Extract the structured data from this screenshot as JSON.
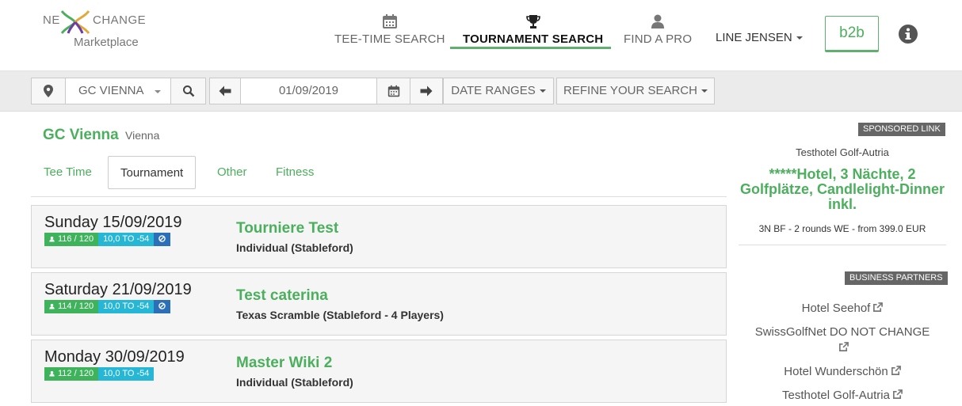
{
  "brand": {
    "logo_left": "NE",
    "logo_right": "CHANGE",
    "logo_sub": "Marketplace",
    "accent_color": "#4caf5d"
  },
  "nav": {
    "items": [
      {
        "label": "TEE-TIME SEARCH",
        "icon": "calendar-icon",
        "active": false
      },
      {
        "label": "TOURNAMENT SEARCH",
        "icon": "trophy-icon",
        "active": true
      },
      {
        "label": "FIND A PRO",
        "icon": "user-icon",
        "active": false
      }
    ],
    "user_name": "LINE JENSEN",
    "b2b_label": "b2b",
    "info_icon": "info-circle-icon"
  },
  "search": {
    "location_icon": "map-marker-icon",
    "club": "GC VIENNA",
    "search_icon": "search-icon",
    "prev_icon": "arrow-left-icon",
    "date": "01/09/2019",
    "calendar_icon": "calendar-icon",
    "next_icon": "arrow-right-icon",
    "date_ranges": "DATE RANGES",
    "refine": "REFINE YOUR SEARCH"
  },
  "club": {
    "name": "GC Vienna",
    "city": "Vienna"
  },
  "tabs": [
    {
      "label": "Tee Time",
      "active": false
    },
    {
      "label": "Tournament",
      "active": true
    },
    {
      "label": "Other",
      "active": false
    },
    {
      "label": "Fitness",
      "active": false
    }
  ],
  "events": [
    {
      "date": "Sunday 15/09/2019",
      "spots": "116 / 120",
      "handicap": "10,0 TO -54",
      "has_ban": true,
      "name": "Tourniere Test",
      "format": "Individual (Stableford)"
    },
    {
      "date": "Saturday 21/09/2019",
      "spots": "114 / 120",
      "handicap": "10,0 TO -54",
      "has_ban": true,
      "name": "Test caterina",
      "format": "Texas Scramble (Stableford - 4 Players)"
    },
    {
      "date": "Monday 30/09/2019",
      "spots": "112 / 120",
      "handicap": "10,0 TO -54",
      "has_ban": false,
      "name": "Master Wiki 2",
      "format": "Individual (Stableford)"
    }
  ],
  "sidebar": {
    "sponsored_label": "SPONSORED LINK",
    "sponsor_name": "Testhotel Golf-Autria",
    "sponsor_headline": "*****Hotel, 3 Nächte, 2 Golfplätze, Candlelight-Dinner inkl.",
    "sponsor_desc": "3N BF - 2 rounds WE - from 399.0 EUR",
    "partners_label": "BUSINESS PARTNERS",
    "partners": [
      "Hotel Seehof",
      "SwissGolfNet DO NOT CHANGE",
      "Hotel Wunderschön",
      "Testhotel Golf-Autria"
    ]
  }
}
